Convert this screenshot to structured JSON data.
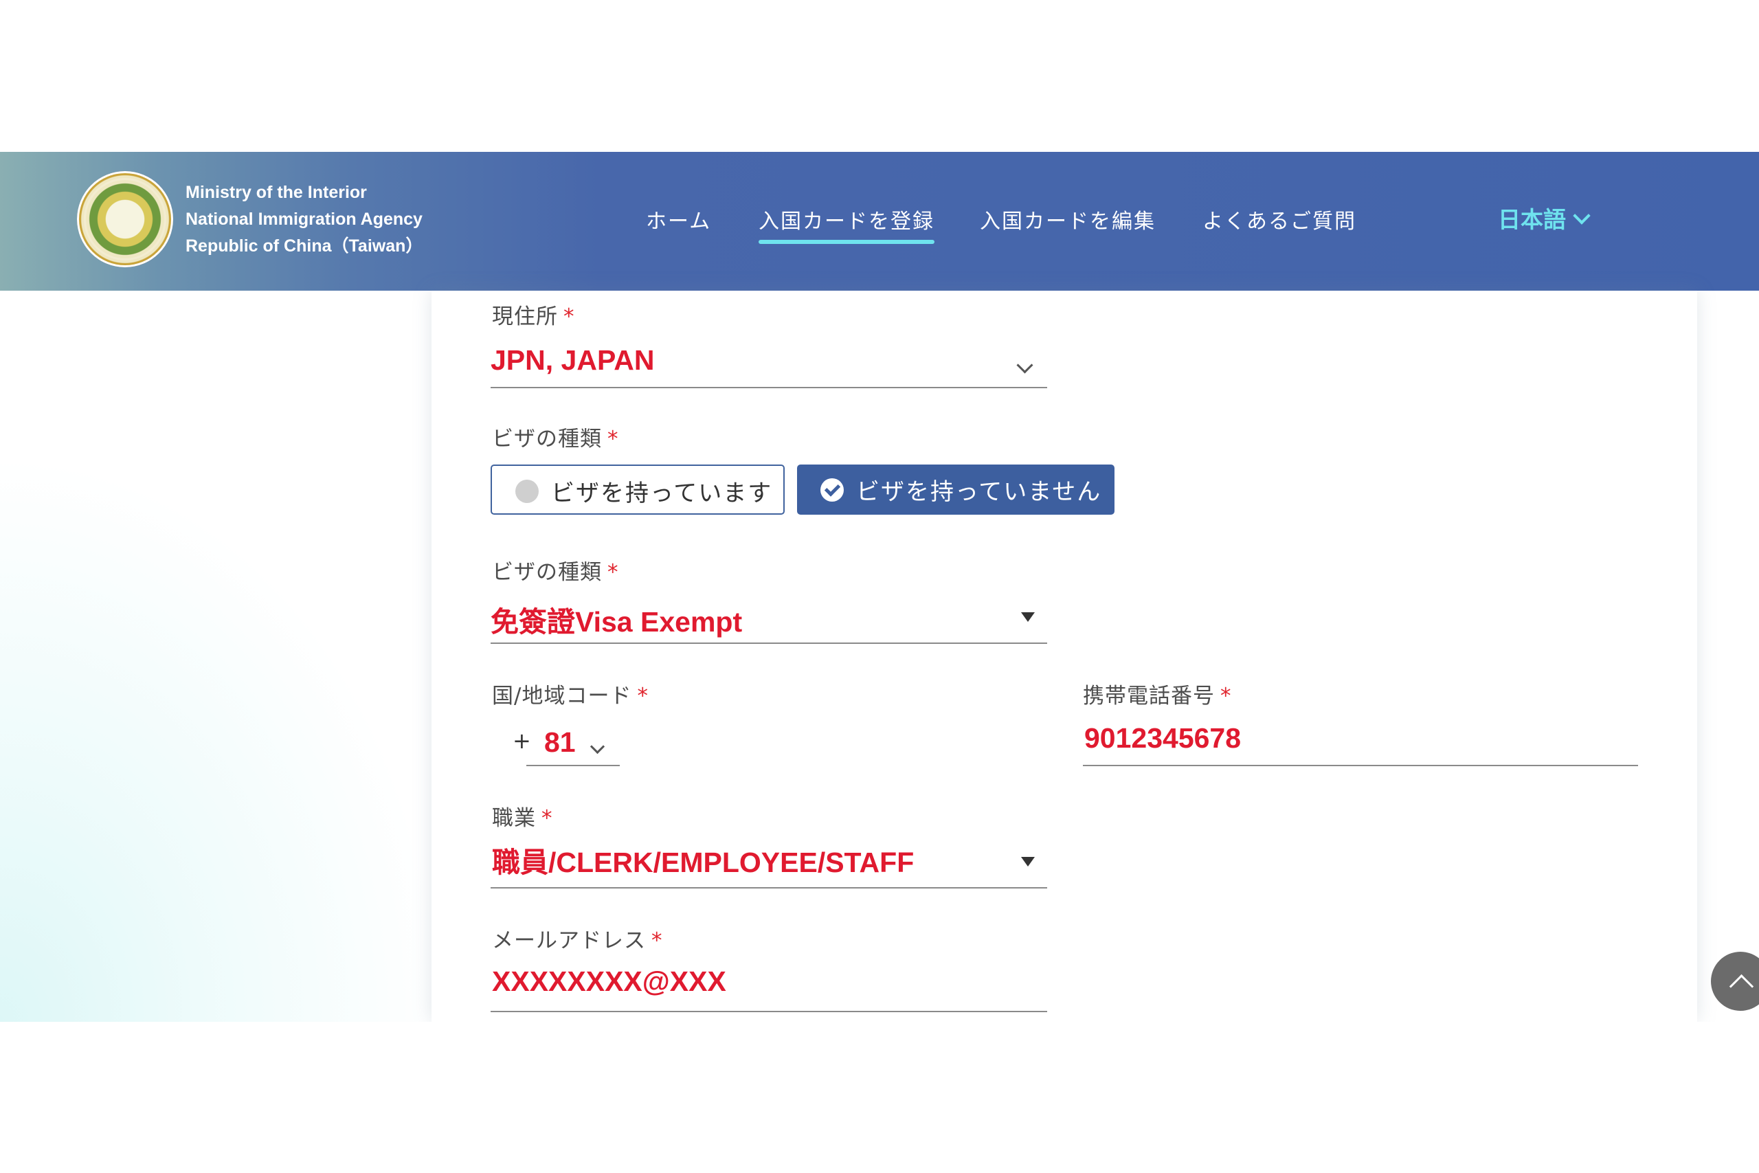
{
  "header": {
    "org_lines": [
      "Ministry of the Interior",
      "National Immigration Agency",
      "Republic of China（Taiwan）"
    ],
    "nav": [
      {
        "label": "ホーム",
        "active": false
      },
      {
        "label": "入国カードを登録",
        "active": true
      },
      {
        "label": "入国カードを編集",
        "active": false
      },
      {
        "label": "よくあるご質問",
        "active": false
      }
    ],
    "language": "日本語"
  },
  "form": {
    "residence": {
      "label": "現住所",
      "required": "*",
      "value": "JPN, JAPAN"
    },
    "visa_status": {
      "label": "ビザの種類",
      "required": "*",
      "options": [
        {
          "label": "ビザを持っています",
          "selected": false
        },
        {
          "label": "ビザを持っていません",
          "selected": true
        }
      ]
    },
    "visa_type": {
      "label": "ビザの種類",
      "required": "*",
      "value": "免簽證Visa Exempt"
    },
    "country_code": {
      "label": "国/地域コード",
      "required": "*",
      "prefix": "+",
      "value": "81"
    },
    "mobile": {
      "label": "携帯電話番号",
      "required": "*",
      "value": "9012345678"
    },
    "occupation": {
      "label": "職業",
      "required": "*",
      "value": "職員/CLERK/EMPLOYEE/STAFF"
    },
    "email": {
      "label": "メールアドレス",
      "required": "*",
      "value": "XXXXXXXX@XXX"
    }
  },
  "colors": {
    "header_blue": "#4364ab",
    "accent_cyan": "#6fe3ee",
    "value_red": "#e01a2f",
    "selected_button": "#3d5f9f"
  },
  "icons": [
    "emblem-logo",
    "chevron-down-icon",
    "dropdown-triangle-icon",
    "radio-dot-icon",
    "check-circle-icon",
    "back-to-top-icon"
  ]
}
